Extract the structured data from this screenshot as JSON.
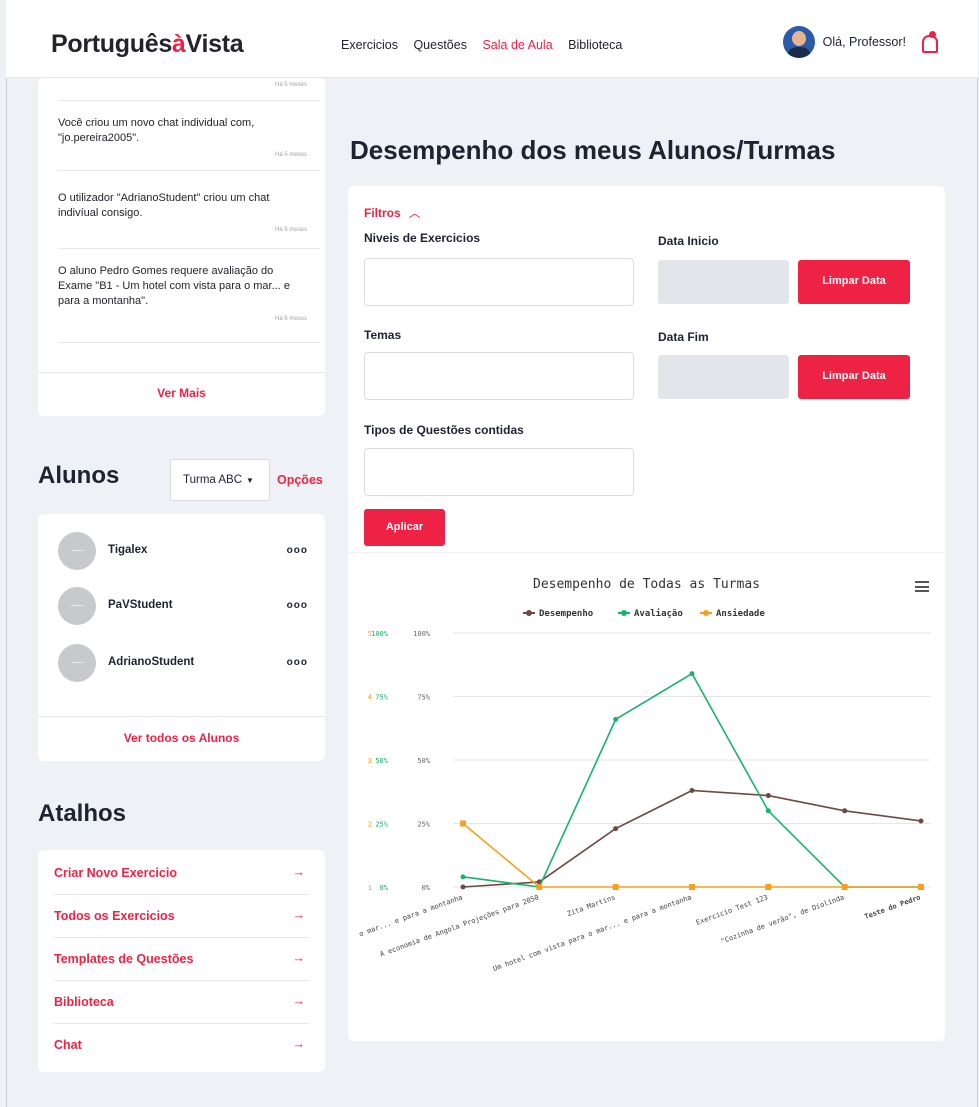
{
  "header": {
    "logo_part1": "Português",
    "logo_accent": "à",
    "logo_part2": "Vista",
    "nav": [
      "Exercicios",
      "Questões",
      "Sala de Aula",
      "Biblioteca"
    ],
    "active_nav": "Sala de Aula",
    "greeting": "Olá, Professor!"
  },
  "notifications": {
    "items": [
      {
        "text": "",
        "time": "Há 5 meses"
      },
      {
        "text": "Você criou um novo chat individual com, \"jo.pereira2005\".",
        "time": "Há 5 meses"
      },
      {
        "text": "O utilizador \"AdrianoStudent\" criou um chat indivíual consigo.",
        "time": "Há 6 meses"
      },
      {
        "text": "O aluno Pedro Gomes requere avaliação do Exame \"B1 - Um hotel com vista para o mar... e para a montanha\".",
        "time": "Há 6 meses"
      }
    ],
    "more_label": "Ver Mais"
  },
  "students": {
    "title": "Alunos",
    "class_select": "Turma ABC",
    "options_label": "Opções",
    "list": [
      {
        "name": "Tigalex"
      },
      {
        "name": "PaVStudent"
      },
      {
        "name": "AdrianoStudent"
      }
    ],
    "dots": "ooo",
    "all_label": "Ver todos os Alunos"
  },
  "shortcuts": {
    "title": "Atalhos",
    "items": [
      "Criar Novo Exercicio",
      "Todos os Exercicios",
      "Templates de Questões",
      "Biblioteca",
      "Chat"
    ],
    "arrow": "→"
  },
  "main": {
    "title": "Desempenho dos meus Alunos/Turmas",
    "filters_label": "Filtros",
    "levels_label": "Niveis de Exercicios",
    "themes_label": "Temas",
    "types_label": "Tipos de Questões contidas",
    "start_label": "Data Inicio",
    "end_label": "Data Fim",
    "clear_label": "Limpar Data",
    "apply_label": "Aplicar"
  },
  "chart_data": {
    "type": "line",
    "title": "Desempenho de Todas as Turmas",
    "categories": [
      "o mar... e para a montanha",
      "A economia de Angola Projeções para 2050",
      "Zita Martins",
      "Um hotel com vista para o mar... e para a montanha",
      "Exercicio Test 123",
      "\"Cozinha de verão\", de Diolinda",
      "Teste do Pedro"
    ],
    "series": [
      {
        "name": "Desempenho",
        "color": "#6b4a44",
        "values": [
          0,
          2,
          23,
          38,
          36,
          30,
          26
        ]
      },
      {
        "name": "Avaliação",
        "color": "#19b36b",
        "values": [
          4,
          0,
          66,
          84,
          30,
          0,
          0
        ]
      },
      {
        "name": "Ansiedade",
        "color": "#f5a020",
        "values": [
          25,
          0,
          0,
          0,
          0,
          0,
          0
        ]
      }
    ],
    "axes": [
      {
        "ticks": [
          "1",
          "2",
          "3",
          "4",
          "5"
        ],
        "color": "#f5a020"
      },
      {
        "ticks": [
          "0%",
          "25%",
          "50%",
          "75%",
          "100%"
        ],
        "color": "#19b36b"
      },
      {
        "ticks": [
          "0%",
          "25%",
          "50%",
          "75%",
          "100%"
        ],
        "color": "#666666"
      }
    ],
    "ylim": [
      0,
      100
    ],
    "grid": true,
    "legend": "top"
  }
}
